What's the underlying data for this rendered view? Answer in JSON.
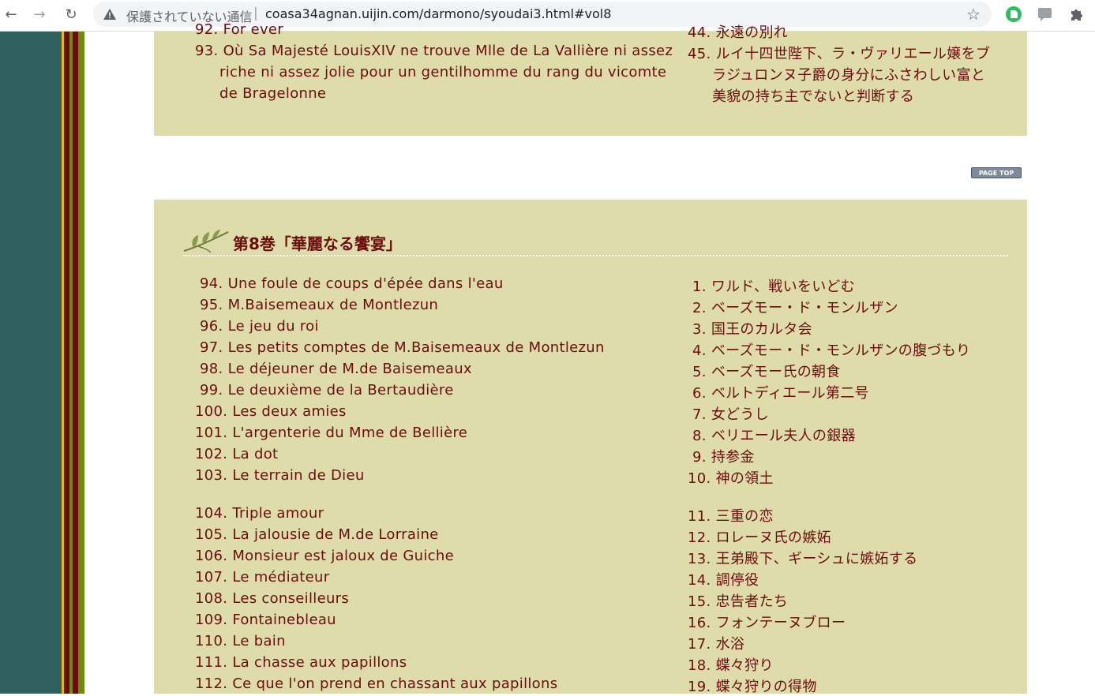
{
  "browser": {
    "security_text": "保護されていない通信",
    "separator": "|",
    "url": "coasa34agnan.uijin.com/darmono/syoudai3.html#vol8"
  },
  "colors": {
    "text": "#6b0d0d",
    "box_bg": "#dedcaa",
    "left_panel": "#2f6060",
    "stripe_yellow": "#e8b800",
    "stripe_maroon": "#6b0d0d",
    "stripe_green": "#6e8a10"
  },
  "prev_section": {
    "fr": [
      {
        "num": "92.",
        "text": "For ever"
      },
      {
        "num": "93.",
        "text": "Où Sa Majesté LouisXIV ne trouve Mlle de La Vallière ni assez",
        "cont": [
          "riche ni assez jolie pour un gentilhomme du rang du vicomte",
          "de Bragelonne"
        ]
      }
    ],
    "jp": [
      {
        "num": "44.",
        "text": "永遠の別れ"
      },
      {
        "num": "45.",
        "text": "ルイ十四世陛下、ラ・ヴァリエール嬢をブ",
        "cont": [
          "ラジュロンヌ子爵の身分にふさわしい富と",
          "美貌の持ち主でないと判断する"
        ]
      }
    ]
  },
  "page_top_label": "PAGE TOP",
  "section": {
    "title": "第8巻「華麗なる饗宴」",
    "fr_group1": [
      {
        "num": "94.",
        "text": "Une foule de coups d'épée dans l'eau"
      },
      {
        "num": "95.",
        "text": "M.Baisemeaux de Montlezun"
      },
      {
        "num": "96.",
        "text": "Le jeu du roi"
      },
      {
        "num": "97.",
        "text": "Les petits comptes de M.Baisemeaux de Montlezun"
      },
      {
        "num": "98.",
        "text": "Le déjeuner de M.de Baisemeaux"
      },
      {
        "num": "99.",
        "text": "Le deuxième de la Bertaudière"
      },
      {
        "num": "100.",
        "text": "Les deux amies"
      },
      {
        "num": "101.",
        "text": "L'argenterie du Mme de Bellière"
      },
      {
        "num": "102.",
        "text": "La dot"
      },
      {
        "num": "103.",
        "text": "Le terrain de Dieu"
      }
    ],
    "fr_group2": [
      {
        "num": "104.",
        "text": "Triple amour"
      },
      {
        "num": "105.",
        "text": "La jalousie de M.de Lorraine"
      },
      {
        "num": "106.",
        "text": "Monsieur est jaloux de Guiche"
      },
      {
        "num": "107.",
        "text": "Le médiateur"
      },
      {
        "num": "108.",
        "text": "Les conseilleurs"
      },
      {
        "num": "109.",
        "text": "Fontainebleau"
      },
      {
        "num": "110.",
        "text": "Le bain"
      },
      {
        "num": "111.",
        "text": "La chasse aux papillons"
      },
      {
        "num": "112.",
        "text": "Ce que l'on prend en chassant aux papillons"
      }
    ],
    "jp_group1": [
      {
        "num": "1.",
        "text": "ワルド、戦いをいどむ"
      },
      {
        "num": "2.",
        "text": "ベーズモー・ド・モンルザン"
      },
      {
        "num": "3.",
        "text": "国王のカルタ会"
      },
      {
        "num": "4.",
        "text": "ベーズモー・ド・モンルザンの腹づもり"
      },
      {
        "num": "5.",
        "text": "ベーズモー氏の朝食"
      },
      {
        "num": "6.",
        "text": "ベルトディエール第二号"
      },
      {
        "num": "7.",
        "text": "女どうし"
      },
      {
        "num": "8.",
        "text": "ベリエール夫人の銀器"
      },
      {
        "num": "9.",
        "text": "持参金"
      },
      {
        "num": "10.",
        "text": "神の領土"
      }
    ],
    "jp_group2": [
      {
        "num": "11.",
        "text": "三重の恋"
      },
      {
        "num": "12.",
        "text": "ロレーヌ氏の嫉妬"
      },
      {
        "num": "13.",
        "text": "王弟殿下、ギーシュに嫉妬する"
      },
      {
        "num": "14.",
        "text": "調停役"
      },
      {
        "num": "15.",
        "text": "忠告者たち"
      },
      {
        "num": "16.",
        "text": "フォンテーヌブロー"
      },
      {
        "num": "17.",
        "text": "水浴"
      },
      {
        "num": "18.",
        "text": "蝶々狩り"
      },
      {
        "num": "19.",
        "text": "蝶々狩りの得物"
      }
    ]
  }
}
